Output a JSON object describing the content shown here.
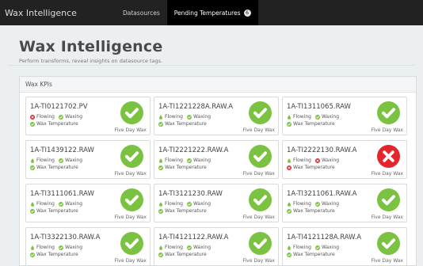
{
  "app": {
    "brand": "Wax Intelligence",
    "nav": [
      {
        "label": "Datasources",
        "active": false
      },
      {
        "label": "Pending Temperatures",
        "active": true,
        "badge": "6"
      }
    ]
  },
  "page": {
    "title": "Wax Intelligence",
    "subtitle": "Perform transforms, reveal insights on datasource tags."
  },
  "panel": {
    "title": "Wax KPIs"
  },
  "colors": {
    "ok": "#7cc242",
    "bad": "#e3262c",
    "drop": "#7cc242"
  },
  "labels": {
    "flowing": "Flowing",
    "waxing": "Waxing",
    "wax_temperature": "Wax Temperature",
    "five_day_wax": "Five Day Wax"
  },
  "cards": [
    {
      "name": "1A-TI0121702.PV",
      "flowing": "bad",
      "waxing": "ok",
      "wax": "ok"
    },
    {
      "name": "1A-TI1221228A.RAW.A",
      "flowing": "drop",
      "waxing": "ok",
      "wax": "ok"
    },
    {
      "name": "1A-TI1311065.RAW",
      "flowing": "drop",
      "waxing": "ok",
      "wax": "ok"
    },
    {
      "name": "1A-TI1439122.RAW",
      "flowing": "drop",
      "waxing": "ok",
      "wax": "ok"
    },
    {
      "name": "1A-TI2221222.RAW.A",
      "flowing": "drop",
      "waxing": "ok",
      "wax": "ok"
    },
    {
      "name": "1A-TI2222130.RAW.A",
      "flowing": "drop",
      "waxing": "bad",
      "wax": "bad"
    },
    {
      "name": "1A-TI3111061.RAW",
      "flowing": "drop",
      "waxing": "ok",
      "wax": "ok"
    },
    {
      "name": "1A-TI3121230.RAW",
      "flowing": "drop",
      "waxing": "ok",
      "wax": "ok"
    },
    {
      "name": "1A-TI3211061.RAW.A",
      "flowing": "drop",
      "waxing": "ok",
      "wax": "ok"
    },
    {
      "name": "1A-TI3322130.RAW.A",
      "flowing": "drop",
      "waxing": "ok",
      "wax": "ok"
    },
    {
      "name": "1A-TI4121122.RAW.A",
      "flowing": "drop",
      "waxing": "ok",
      "wax": "ok"
    },
    {
      "name": "1A-TI4121128A.RAW.A",
      "flowing": "drop",
      "waxing": "ok",
      "wax": "ok"
    }
  ]
}
